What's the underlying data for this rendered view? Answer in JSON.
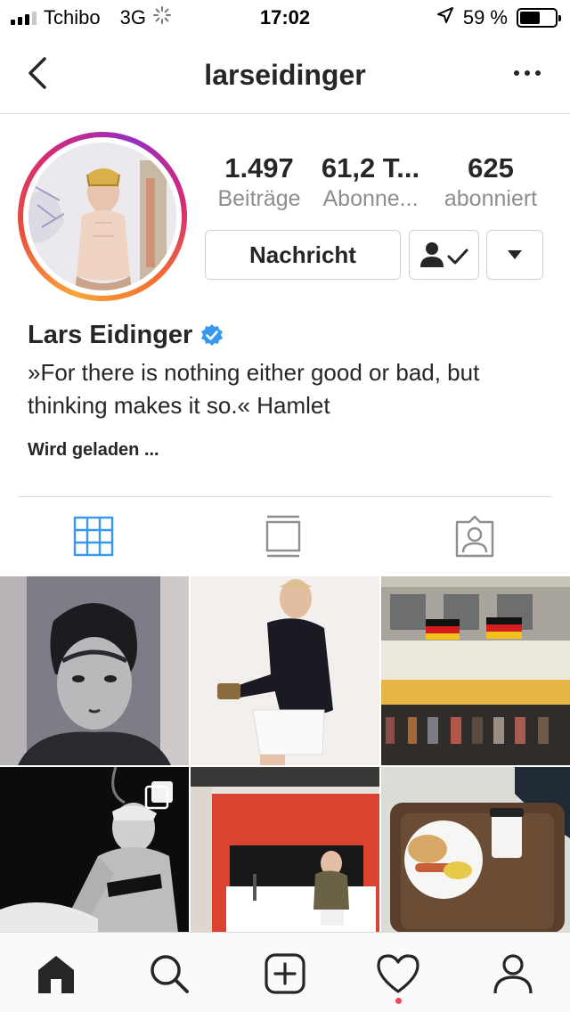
{
  "status_bar": {
    "carrier": "Tchibo",
    "network": "3G",
    "time": "17:02",
    "battery_percent": "59 %",
    "battery_level": 0.59,
    "signal_bars_active": 3,
    "icons": [
      "signal-icon",
      "loading-spinner-icon",
      "location-arrow-icon",
      "battery-icon"
    ]
  },
  "header": {
    "username": "larseidinger",
    "icons": [
      "back-chevron-icon",
      "more-options-icon"
    ]
  },
  "profile": {
    "stats": [
      {
        "value": "1.497",
        "label": "Beiträge"
      },
      {
        "value": "61,2 T...",
        "label": "Abonne..."
      },
      {
        "value": "625",
        "label": "abonniert"
      }
    ],
    "message_button": "Nachricht",
    "display_name": "Lars Eidinger",
    "verified": true,
    "bio": "»For there is nothing either good or bad, but thinking makes it so.« Hamlet",
    "loading_text": "Wird geladen ...",
    "story_ring_colors": [
      "#f9a53a",
      "#ea4f3c",
      "#d62976",
      "#962fbf"
    ]
  },
  "tabs": [
    {
      "icon": "grid-icon",
      "active": true
    },
    {
      "icon": "feed-view-icon",
      "active": false
    },
    {
      "icon": "tagged-photos-icon",
      "active": false
    }
  ],
  "posts": [
    {
      "content": "portrait-painting",
      "multiple": false
    },
    {
      "content": "man-in-black-sweater",
      "multiple": false
    },
    {
      "content": "building-with-flags",
      "multiple": false
    },
    {
      "content": "stage-performance",
      "multiple": true
    },
    {
      "content": "hotel-room-red-wall",
      "multiple": false
    },
    {
      "content": "food-tray",
      "multiple": false
    }
  ],
  "bottom_nav": {
    "items": [
      "home-icon",
      "search-icon",
      "new-post-icon",
      "activity-heart-icon",
      "profile-icon"
    ],
    "active": "home-icon",
    "has_activity_notification": true
  },
  "colors": {
    "accent_blue": "#3897f0",
    "text_primary": "#262626",
    "text_secondary": "#8e8e8e",
    "border": "#dbdbdb",
    "notification_red": "#ed4956"
  }
}
